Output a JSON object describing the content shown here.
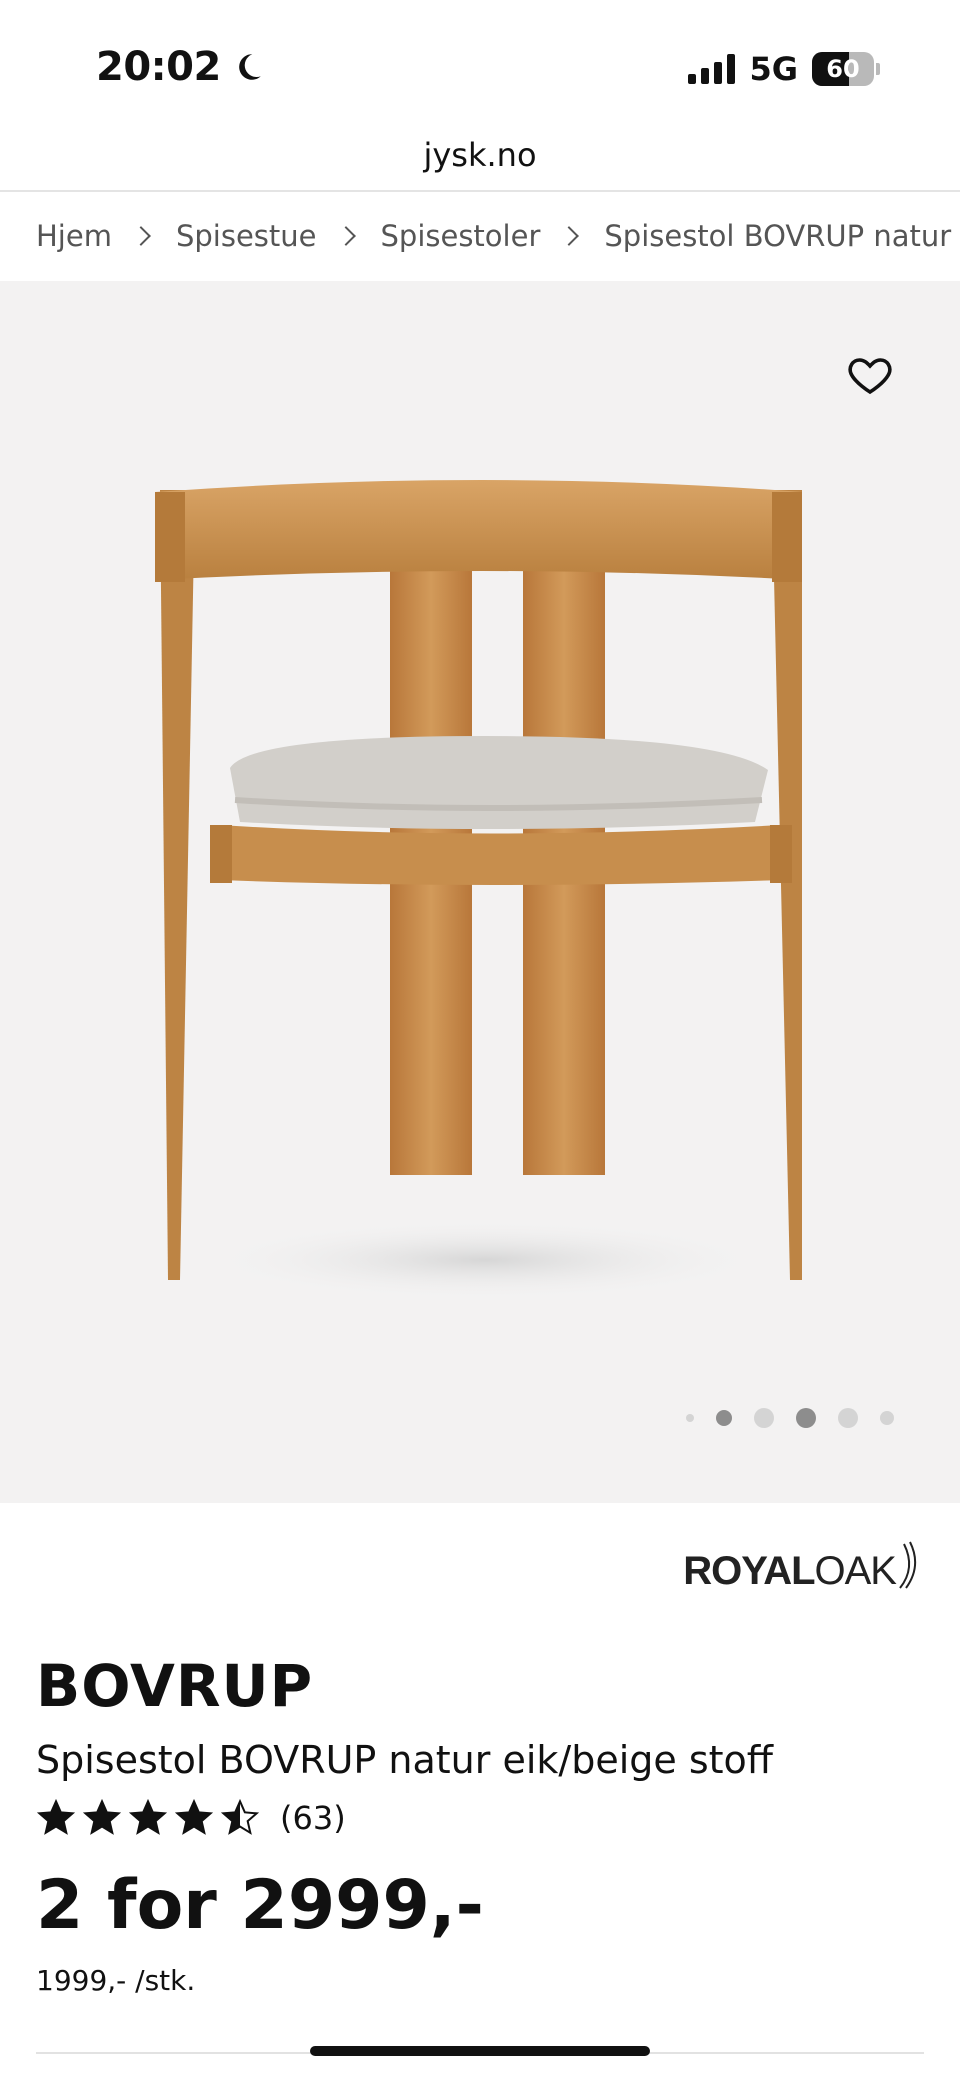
{
  "status_bar": {
    "time": "20:02",
    "network": "5G",
    "battery_level": "60",
    "battery_fraction": 0.6
  },
  "url_bar": {
    "url": "jysk.no"
  },
  "breadcrumb": [
    "Hjem",
    "Spisestue",
    "Spisestoler",
    "Spisestol BOVRUP natur eik"
  ],
  "gallery": {
    "image_count": 6,
    "active_index": 3
  },
  "brand": {
    "part1": "ROYAL",
    "part2": "OAK"
  },
  "product": {
    "name": "BOVRUP",
    "subtitle": "Spisestol BOVRUP natur eik/beige stoff",
    "rating_value": 4.5,
    "rating_count": "(63)",
    "price": "2 for 2999,-",
    "unit_price": "1999,- /stk."
  },
  "colors": {
    "hero_bg": "#f3f2f2",
    "text": "#111111",
    "wood": "#c48a4a"
  }
}
